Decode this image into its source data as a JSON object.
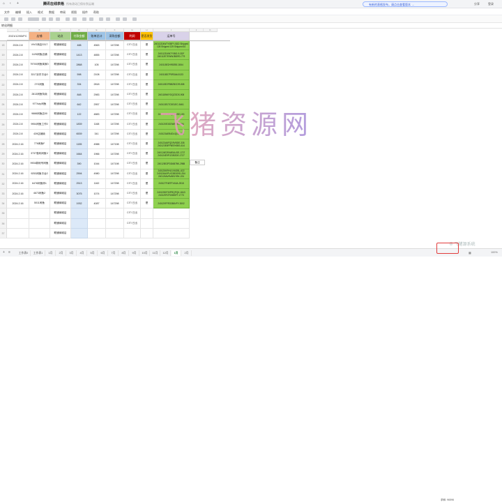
{
  "app": {
    "title": "腾讯在线表格",
    "saved_status": "所有改动已保存到云端",
    "notice": "有新的表格发布，请点击查看版本 →",
    "account_label": "分享",
    "account_label2": "登录"
  },
  "menu": [
    "文件",
    "编辑",
    "插入",
    "格式",
    "数据",
    "审阅",
    "视图",
    "插件",
    "帮助"
  ],
  "formula_bar": {
    "cell_ref": "转化明细"
  },
  "column_letters": [
    "A",
    "B",
    "C",
    "D",
    "E",
    "F",
    "G",
    "H",
    "I",
    "J",
    "K"
  ],
  "headers": [
    "2021/12/03/FC",
    "店铺",
    "站点",
    "付款金额",
    "账单总计",
    "采购金额",
    "利润",
    "是否发货",
    "运单号"
  ],
  "header_colors": [
    "#ffffff",
    "#f4b183",
    "#a9d18e",
    "#70ad47",
    "#9dc3e6",
    "#9dc3e6",
    "#c00000",
    "#ffc000",
    "#d9d2e9"
  ],
  "row_numbers": [
    "18",
    "19",
    "20",
    "21",
    "22",
    "23",
    "24",
    "25",
    "26",
    "27",
    "28",
    "29",
    "30",
    "31",
    "32",
    "33",
    "34",
    "35",
    "36",
    "37"
  ],
  "rows": [
    {
      "date": "2024.2.8",
      "store": "VIVO商店0317",
      "site": "联通商城店",
      "pay": "488",
      "total": "4563",
      "cost": "147298",
      "profit": "CITI 已出",
      "ship": "是",
      "tracking": "240112D4W7Y0BFY-5DD Shipped 128 Shipped 129 Shipped 64"
    },
    {
      "date": "2024.2.8",
      "store": "1125闲鱼店铺",
      "site": "联通商城店",
      "pay": "1413",
      "total": "4855",
      "cost": "147298",
      "profit": "CITI 已出",
      "ship": "是",
      "tracking": "240112D4W7Y0BG-9-3DF 240112E7EWWJBDRD-779"
    },
    {
      "date": "2024.2.8",
      "store": "79700闲鱼商家0",
      "site": "联通商城店",
      "pay": "2868",
      "total": "105",
      "cost": "147298",
      "profit": "CITI 已出",
      "ship": "是",
      "tracking": "240115E2H99ZBE-3064"
    },
    {
      "date": "2024.2.8",
      "store": "3317京东平台0",
      "site": "联通商城店",
      "pay": "598",
      "total": "2108",
      "cost": "147298",
      "profit": "CITI 已出",
      "ship": "是",
      "tracking": "240118D7P0R3A6-5133"
    },
    {
      "date": "2024.2.8",
      "store": "27G闲鱼",
      "site": "联通商城店",
      "pay": "334",
      "total": "2818",
      "cost": "147298",
      "profit": "CITI 已出",
      "ship": "是",
      "tracking": "240115E2FBBZBCDR-808"
    },
    {
      "date": "2024.2.8",
      "store": "2813闲鱼特卖",
      "site": "联通商城店",
      "pay": "848",
      "total": "2983",
      "cost": "147298",
      "profit": "CITI 已出",
      "ship": "是",
      "tracking": "240118W0YDQZGDS-908"
    },
    {
      "date": "2024.2.8",
      "store": "9774vip闲鱼",
      "site": "联通商城店",
      "pay": "642",
      "total": "2957",
      "cost": "147298",
      "profit": "CITI 已出",
      "ship": "是",
      "tracking": "240113EJ7C5S1EC-5461"
    },
    {
      "date": "2024.2.8",
      "store": "9888闲鱼店00",
      "site": "联通商城店",
      "pay": "122",
      "total": "4883",
      "cost": "147298",
      "profit": "CITI 已出",
      "ship": "是",
      "tracking": "240115E9R4QFBBSE-153"
    },
    {
      "date": "2024.2.8",
      "store": "9954闲鱼工作0",
      "site": "联通商城店",
      "pay": "1839",
      "total": "1168",
      "cost": "147298",
      "profit": "CITI 已出",
      "ship": "是",
      "tracking": "240120E3GDWEB9-3694"
    },
    {
      "date": "2024.2.8",
      "store": "439店铺卖",
      "site": "联通商城店",
      "pay": "6539",
      "total": "341",
      "cost": "147298",
      "profit": "CITI 已出",
      "ship": "是",
      "tracking": "240123AEB4DUQGJ-803"
    },
    {
      "date": "2024.2.16",
      "store": "776闲鱼F",
      "site": "联通商城店",
      "pay": "1155",
      "total": "4988",
      "cost": "147198",
      "profit": "CITI 已出",
      "ship": "是",
      "tracking": "240123A6FQD9VBDE-335 240123E8FP6E5Y6BS-614"
    },
    {
      "date": "2024.2.16",
      "store": "3737惠利闲鱼V",
      "site": "联通商城店",
      "pay": "1664",
      "total": "1966",
      "cost": "147298",
      "profit": "CITI 已出",
      "ship": "是",
      "tracking": "240124E2RA8S4UGE-1727 240124E9PJZ1B2DE-1727"
    },
    {
      "date": "2024.2.16",
      "store": "9904款帐号闲鱼",
      "site": "联通商城店",
      "pay": "390",
      "total": "1044",
      "cost": "147198",
      "profit": "CITI 已出",
      "ship": "是",
      "tracking": "240125E2PDD6B7BK-2988"
    },
    {
      "date": "2024.2.16",
      "store": "9253闲鱼平台2",
      "site": "联通商城店",
      "pay": "2594",
      "total": "4980",
      "cost": "147298",
      "profit": "CITI 已出",
      "ship": "是",
      "tracking": "240125KRHU1V6GBL-622 240126AXPUG3B3G9D-254 240126AV5VAB1YBK-224"
    },
    {
      "date": "2024.2.16",
      "store": "6478闲鱼饰1",
      "site": "联通商城店",
      "pay": "2513",
      "total": "1162",
      "cost": "147298",
      "profit": "CITI 已出",
      "ship": "是",
      "tracking": "240127F48TFXA3A-2518"
    },
    {
      "date": "2024.2.16",
      "store": "4673闲鱼2",
      "site": "联通商城店",
      "pay": "3075",
      "total": "1074",
      "cost": "147298",
      "profit": "CITI 已出",
      "ship": "是",
      "tracking": "240129DF33PRQPQK-1843 240129FZF1BBSFT-1773"
    },
    {
      "date": "2024.2.16",
      "store": "5011闲鱼",
      "site": "联通商城店",
      "pay": "1932",
      "total": "4087",
      "cost": "147298",
      "profit": "CITI 已出",
      "ship": "是",
      "tracking": "240129FFR33B6VFY-3002"
    },
    {
      "date": "",
      "store": "",
      "site": "联通商城店",
      "pay": "",
      "total": "",
      "cost": "",
      "profit": "CITI 已出",
      "ship": "",
      "tracking": ""
    },
    {
      "date": "",
      "store": "",
      "site": "联通商城店",
      "pay": "",
      "total": "",
      "cost": "",
      "profit": "CITI 已出",
      "ship": "",
      "tracking": ""
    },
    {
      "date": "",
      "store": "",
      "site": "联通商城店",
      "pay": "",
      "total": "",
      "cost": "",
      "profit": "",
      "ship": "",
      "tracking": ""
    }
  ],
  "extra_cell": "备注",
  "tabs": [
    "工作表0",
    "工作表1",
    "1月",
    "2月",
    "3月",
    "4月",
    "5月",
    "6月",
    "7月",
    "8月",
    "9月",
    "10月",
    "11月",
    "12月",
    "1月",
    "2月"
  ],
  "active_tab_index": 14,
  "watermark": "飞猪资源网",
  "watermark2": "⊗ 飞猪源系统",
  "status": {
    "sum": "求和: 96596",
    "zoom": "100%"
  },
  "colors": {
    "highlight_border": "#e23b3b",
    "tracking_green": "#8fd14f",
    "active_tab": "#1a7f37"
  }
}
